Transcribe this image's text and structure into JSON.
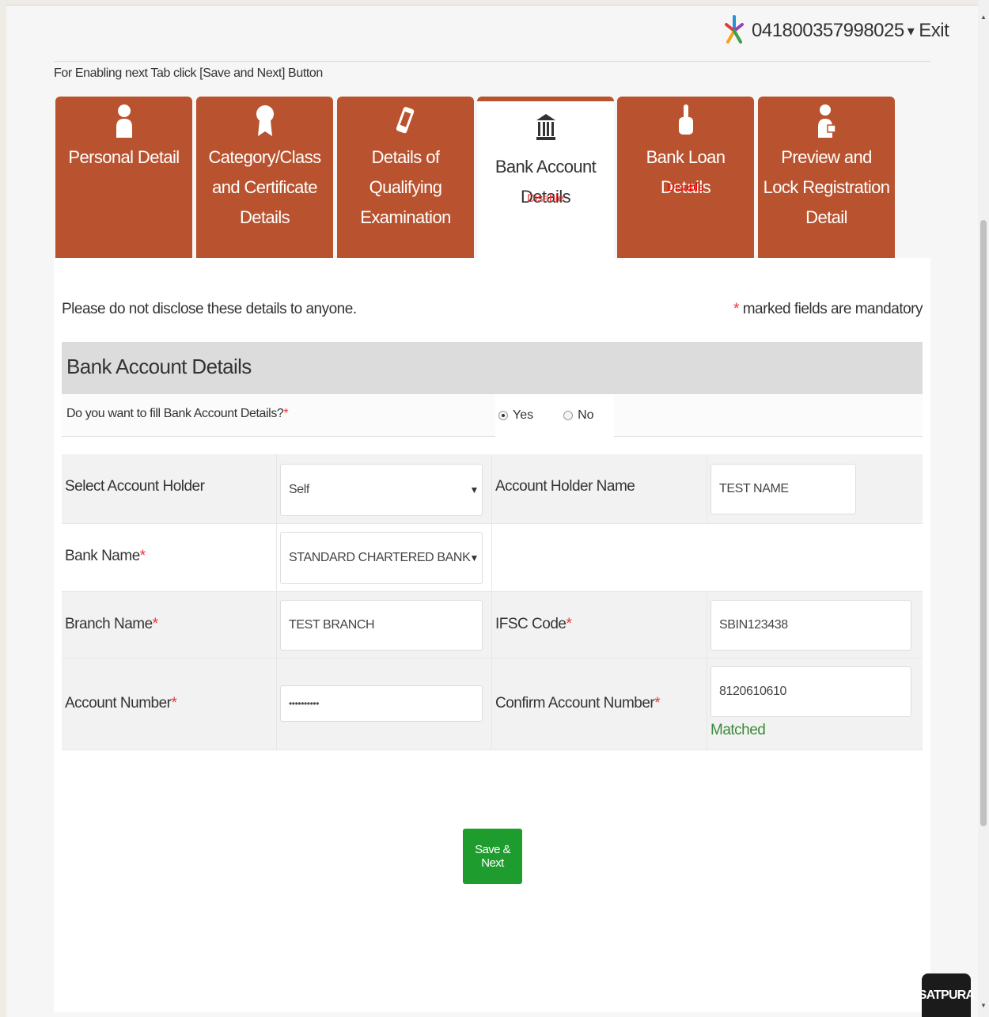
{
  "header": {
    "user_id": "041800357998025",
    "caret": "▾",
    "exit_label": "Exit",
    "hint": "For Enabling next Tab click [Save and Next] Button"
  },
  "tabs": [
    {
      "label": "Personal Detail",
      "icon": "user-icon",
      "status": ""
    },
    {
      "label": "Category/Class and Certificate Details",
      "icon": "certificate-icon",
      "status": ""
    },
    {
      "label": "Details of Qualifying Examination",
      "icon": "phone-icon",
      "status": ""
    },
    {
      "label": "Bank Account Details",
      "icon": "bank-icon",
      "status": "Disable",
      "active": true
    },
    {
      "label": "Bank Loan Details",
      "icon": "hand-icon",
      "status": "Disable"
    },
    {
      "label": "Preview and Lock Registration Detail",
      "icon": "user-lock-icon",
      "status": ""
    }
  ],
  "notes": {
    "privacy": "Please do not disclose these details to anyone.",
    "mandatory_star": "*",
    "mandatory_text": " marked fields are mandatory"
  },
  "section": {
    "title": "Bank Account Details",
    "question": "Do you want to fill Bank Account Details?",
    "required_mark": "*",
    "yes_label": "Yes",
    "no_label": "No",
    "selected": "Yes"
  },
  "form": {
    "account_holder_label": "Select Account Holder",
    "account_holder_value": "Self",
    "holder_name_label": "Account Holder Name",
    "holder_name_value": "TEST NAME",
    "bank_name_label": "Bank Name",
    "bank_name_value": "STANDARD CHARTERED BANK",
    "branch_label": "Branch Name",
    "branch_value": "TEST BRANCH",
    "ifsc_label": "IFSC Code",
    "ifsc_value": "SBIN123438",
    "account_number_label": "Account Number",
    "account_number_value": "••••••••••",
    "confirm_label": "Confirm Account Number",
    "confirm_value": "8120610610",
    "matched_text": "Matched",
    "required_mark": "*",
    "select_arrow": "▼"
  },
  "buttons": {
    "save_next": "Save & Next"
  },
  "badge": {
    "text": "SATPURA"
  },
  "colors": {
    "tab_bg": "#b9532f",
    "save_button": "#1f9c2e",
    "matched": "#3a8a3a",
    "required": "#e33333"
  }
}
